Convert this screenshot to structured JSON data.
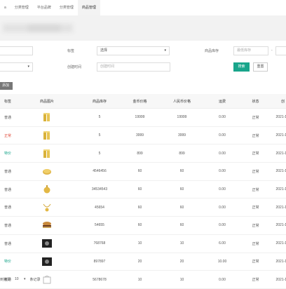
{
  "tabs": [
    {
      "label": "a"
    },
    {
      "label": "分类管理"
    },
    {
      "label": "平台品牌"
    },
    {
      "label": "分类管理"
    },
    {
      "label": "商品管理"
    }
  ],
  "filters": {
    "tag_label": "标签",
    "tag_value": "选择",
    "stock_label": "商品库存",
    "stock_min_placeholder": "最低库存",
    "stock_sep": "-",
    "create_time_label": "创建时间",
    "create_time_placeholder": "创建时间",
    "search_button": "搜索",
    "reset_button": "重置",
    "add_button": "添加"
  },
  "table": {
    "headers": [
      "标签",
      "商品图片",
      "商品库存",
      "金币价格",
      "人民币价格",
      "运费",
      "状态",
      "创"
    ],
    "rows": [
      {
        "tag": "普通",
        "tag_color": "#555555",
        "stock": "5",
        "gold": "19999",
        "rmb": "19999",
        "ship": "0.00",
        "status": "正常",
        "created": "2021-10-",
        "img": "gold-bars"
      },
      {
        "tag": "正常",
        "tag_color": "#e04a3a",
        "stock": "5",
        "gold": "3999",
        "rmb": "3999",
        "ship": "0.00",
        "status": "正常",
        "created": "2021-10-",
        "img": "gold-bars"
      },
      {
        "tag": "特价",
        "tag_color": "#19a58b",
        "stock": "5",
        "gold": "899",
        "rmb": "899",
        "ship": "0.00",
        "status": "正常",
        "created": "2021-10-",
        "img": "gold-bars"
      },
      {
        "tag": "普通",
        "tag_color": "#555555",
        "stock": "4546456",
        "gold": "60",
        "rmb": "60",
        "ship": "0.00",
        "status": "正常",
        "created": "2021-10-",
        "img": "gold-coin"
      },
      {
        "tag": "普通",
        "tag_color": "#555555",
        "stock": "34534543",
        "gold": "60",
        "rmb": "60",
        "ship": "0.00",
        "status": "正常",
        "created": "2021-10-",
        "img": "gold-charm"
      },
      {
        "tag": "普通",
        "tag_color": "#555555",
        "stock": "45654",
        "gold": "60",
        "rmb": "60",
        "ship": "0.00",
        "status": "正常",
        "created": "2021-10-",
        "img": "necklace"
      },
      {
        "tag": "普通",
        "tag_color": "#555555",
        "stock": "54655",
        "gold": "60",
        "rmb": "60",
        "ship": "0.00",
        "status": "正常",
        "created": "2021-10-",
        "img": "burger"
      },
      {
        "tag": "普通",
        "tag_color": "#555555",
        "stock": "768768",
        "gold": "10",
        "rmb": "10",
        "ship": "6.00",
        "status": "正常",
        "created": "2021-10-",
        "img": "dark-photo"
      },
      {
        "tag": "特价",
        "tag_color": "#19a58b",
        "stock": "897897",
        "gold": "20",
        "rmb": "20",
        "ship": "10.00",
        "status": "正常",
        "created": "2021-10-",
        "img": "dark-photo"
      },
      {
        "tag": "普通",
        "tag_color": "#555555",
        "stock": "5678678",
        "gold": "10",
        "rmb": "10",
        "ship": "0.00",
        "status": "正常",
        "created": "2021-10-",
        "img": "outline-box"
      }
    ]
  },
  "pager": {
    "prefix": "到第页",
    "page_size": "10",
    "page_size_unit": "条/页",
    "range_text": "条记录"
  }
}
